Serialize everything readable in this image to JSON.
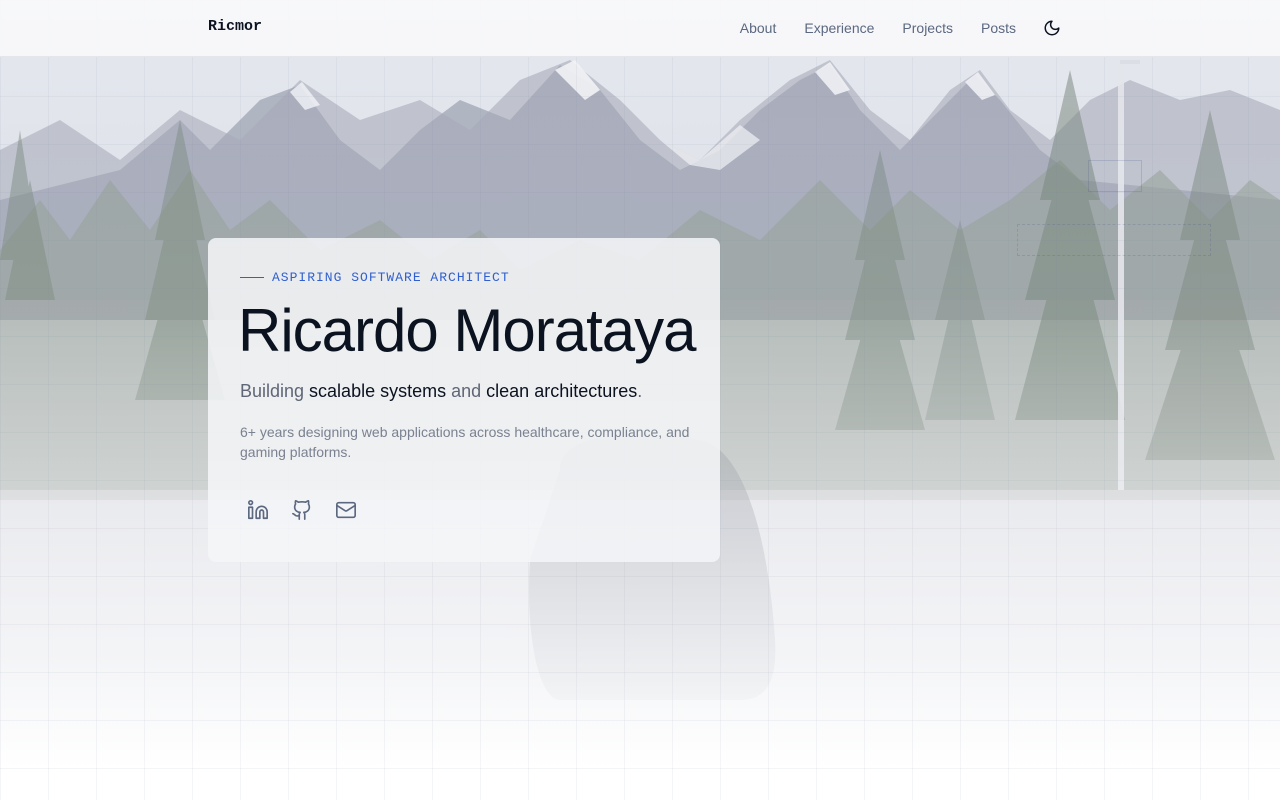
{
  "nav": {
    "brand": "Ricmor",
    "links": [
      {
        "label": "About"
      },
      {
        "label": "Experience"
      },
      {
        "label": "Projects"
      },
      {
        "label": "Posts"
      }
    ],
    "theme_toggle_icon": "moon-icon"
  },
  "hero": {
    "eyebrow": "ASPIRING SOFTWARE ARCHITECT",
    "name": "Ricardo Morataya",
    "tagline": {
      "prefix": "Building ",
      "highlight_1": "scalable systems",
      "middle": " and ",
      "highlight_2": "clean architectures",
      "suffix": "."
    },
    "summary": "6+ years designing web applications across healthcare, compliance, and gaming platforms.",
    "socials": [
      {
        "icon": "linkedin-icon"
      },
      {
        "icon": "github-icon"
      },
      {
        "icon": "mail-icon"
      }
    ]
  },
  "colors": {
    "accent": "#2f5fd0",
    "text_primary": "#0b1220",
    "text_muted": "#5f6675",
    "nav_link": "#5b6880"
  }
}
